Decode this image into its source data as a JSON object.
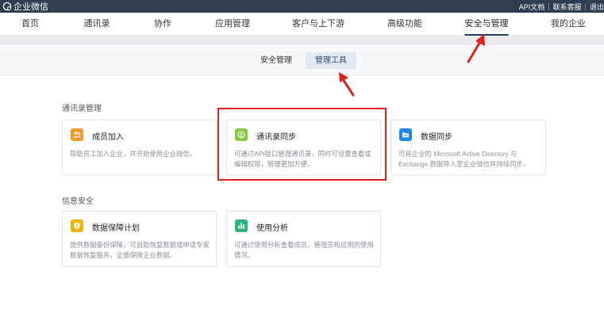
{
  "topbar": {
    "logo_text": "企业微信",
    "links": [
      "API文档",
      "联系客服",
      "退出"
    ]
  },
  "nav": {
    "items": [
      "首页",
      "通讯录",
      "协作",
      "应用管理",
      "客户与上下游",
      "高级功能",
      "安全与管理",
      "我的企业"
    ],
    "active": "安全与管理"
  },
  "subtabs": {
    "items": [
      "安全管理",
      "管理工具"
    ],
    "active": "管理工具"
  },
  "sections": [
    {
      "title": "通讯录管理",
      "cards": [
        {
          "title": "成员加入",
          "desc": "帮助员工加入企业，并开始使用企业微信。",
          "icon": "member-join-icon",
          "color": "#f29a2e"
        },
        {
          "title": "通讯录同步",
          "desc": "可通过API接口管理通讯录，同时可设置查看或编辑权限，管理更加方便。",
          "icon": "contacts-sync-icon",
          "color": "#8cc63f"
        },
        {
          "title": "数据同步",
          "desc": "可将企业的 Microsoft Active Directory 与 Exchange 数据导入至企业微信并持续同步。",
          "icon": "data-sync-icon",
          "color": "#1e88e5"
        }
      ]
    },
    {
      "title": "信息安全",
      "cards": [
        {
          "title": "数据保障计划",
          "desc": "提供数据备份保障，可自助恢复数据或申请专家数据恢复服务，全面保障企业数据。",
          "icon": "data-protection-icon",
          "color": "#f0b400"
        },
        {
          "title": "使用分析",
          "desc": "可通过使用分析查看成员、管理员和应用的使用情况。",
          "icon": "usage-analysis-icon",
          "color": "#2ab37a"
        }
      ]
    }
  ],
  "colors": {
    "topbar": "#2c3e50",
    "highlight_red": "#e02020",
    "subtab_active_bg": "#e3eaf3"
  }
}
